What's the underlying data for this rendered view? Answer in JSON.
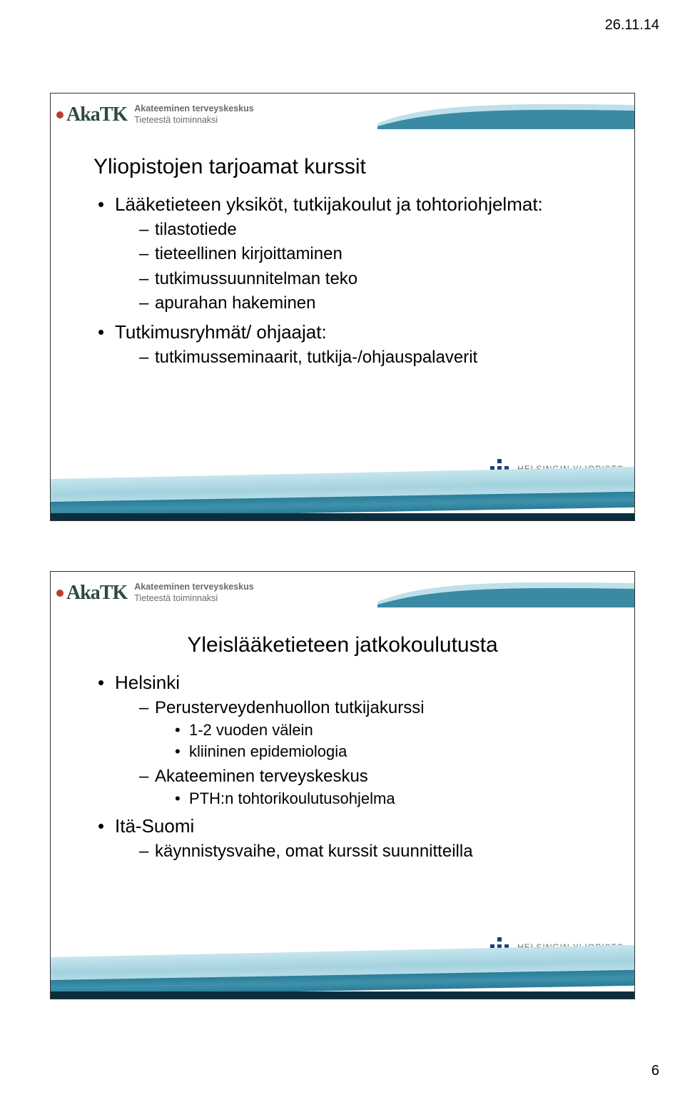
{
  "meta": {
    "date": "26.11.14",
    "page_number": "6"
  },
  "brand": {
    "logo_text": "AkaTK",
    "tagline1": "Akateeminen terveyskeskus",
    "tagline2": "Tieteestä toiminnaksi",
    "university": "HELSINGIN YLIOPISTO"
  },
  "slides": [
    {
      "title": "Yliopistojen tarjoamat kurssit",
      "title_align": "left",
      "bullets": [
        {
          "text": "Lääketieteen yksiköt, tutkijakoulut ja tohtoriohjelmat:",
          "sub": [
            {
              "text": "tilastotiede"
            },
            {
              "text": "tieteellinen kirjoittaminen"
            },
            {
              "text": "tutkimussuunnitelman teko"
            },
            {
              "text": "apurahan hakeminen"
            }
          ]
        },
        {
          "text": "Tutkimusryhmät/ ohjaajat:",
          "sub": [
            {
              "text": "tutkimusseminaarit, tutkija-/ohjauspalaverit"
            }
          ]
        }
      ]
    },
    {
      "title": "Yleislääketieteen jatkokoulutusta",
      "title_align": "center",
      "bullets": [
        {
          "text": "Helsinki",
          "sub": [
            {
              "text": "Perusterveydenhuollon tutkijakurssi",
              "sub": [
                {
                  "text": "1-2 vuoden välein"
                },
                {
                  "text": "kliininen epidemiologia"
                }
              ]
            },
            {
              "text": "Akateeminen terveyskeskus",
              "sub": [
                {
                  "text": "PTH:n tohtorikoulutusohjelma"
                }
              ]
            }
          ]
        },
        {
          "text": "Itä-Suomi",
          "sub": [
            {
              "text": "käynnistysvaihe, omat kurssit suunnitteilla"
            }
          ]
        }
      ]
    }
  ]
}
